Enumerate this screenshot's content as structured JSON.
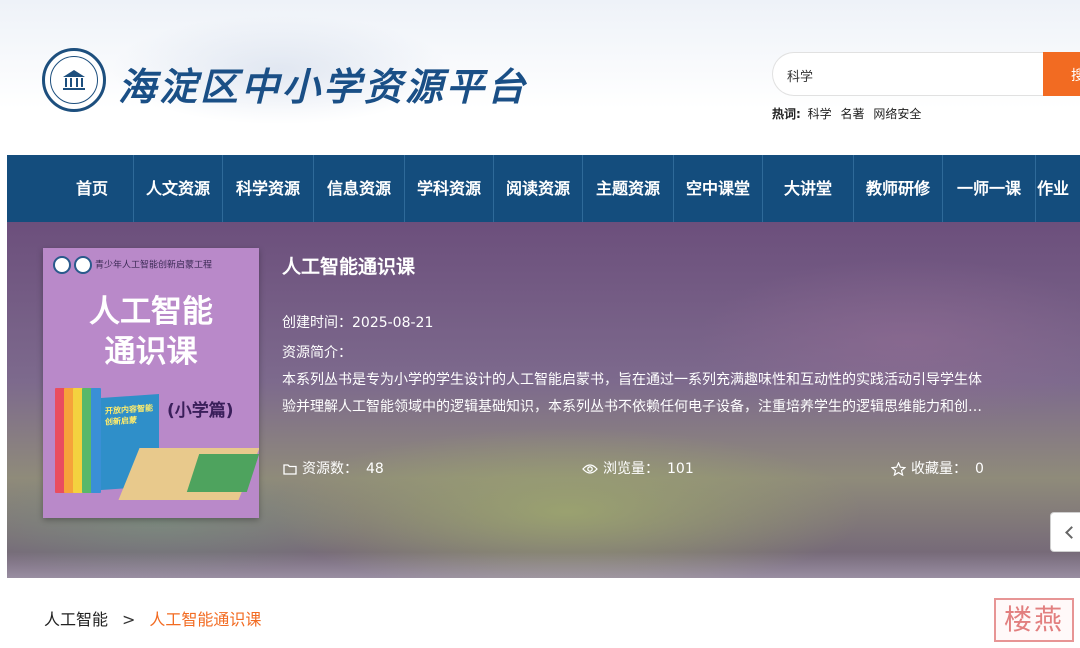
{
  "header": {
    "site_title": "海淀区中小学资源平台",
    "search": {
      "value": "科学",
      "button_label": "搜"
    },
    "hot": {
      "label": "热词:",
      "keywords": [
        "科学",
        "名著",
        "网络安全"
      ]
    }
  },
  "nav": {
    "items": [
      "首页",
      "人文资源",
      "科学资源",
      "信息资源",
      "学科资源",
      "阅读资源",
      "主题资源",
      "空中课堂",
      "大讲堂",
      "教师研修",
      "一师一课",
      "作业"
    ]
  },
  "resource": {
    "cover": {
      "series": "青少年人工智能创新启蒙工程",
      "title_line1": "人工智能",
      "title_line2": "通识课",
      "subtitle": "(小学篇)",
      "book_text": "开放内容智能创新启蒙"
    },
    "title": "人工智能通识课",
    "created": "创建时间：2025-08-21",
    "intro_label": "资源简介：",
    "description_line1": "本系列丛书是专为小学的学生设计的人工智能启蒙书，旨在通过一系列充满趣味性和互动性的实践活动引导学生体",
    "description_line2": "验并理解人工智能领域中的逻辑基础知识，本系列丛书不依赖任何电子设备，注重培养学生的逻辑思维能力和创…",
    "stats": {
      "resources_label": "资源数：",
      "resources_value": "48",
      "views_label": "浏览量：",
      "views_value": "101",
      "favorites_label": "收藏量：",
      "favorites_value": "0"
    }
  },
  "breadcrumb": {
    "parent": "人工智能",
    "separator": ">",
    "current": "人工智能通识课"
  },
  "watermark": "楼燕",
  "colors": {
    "nav_bg": "#144d7d",
    "accent": "#f26b22",
    "title_blue": "#1a4f86"
  },
  "icons": [
    "emblem-logo",
    "folder-icon",
    "eye-icon",
    "star-icon",
    "chevron-left-icon"
  ]
}
